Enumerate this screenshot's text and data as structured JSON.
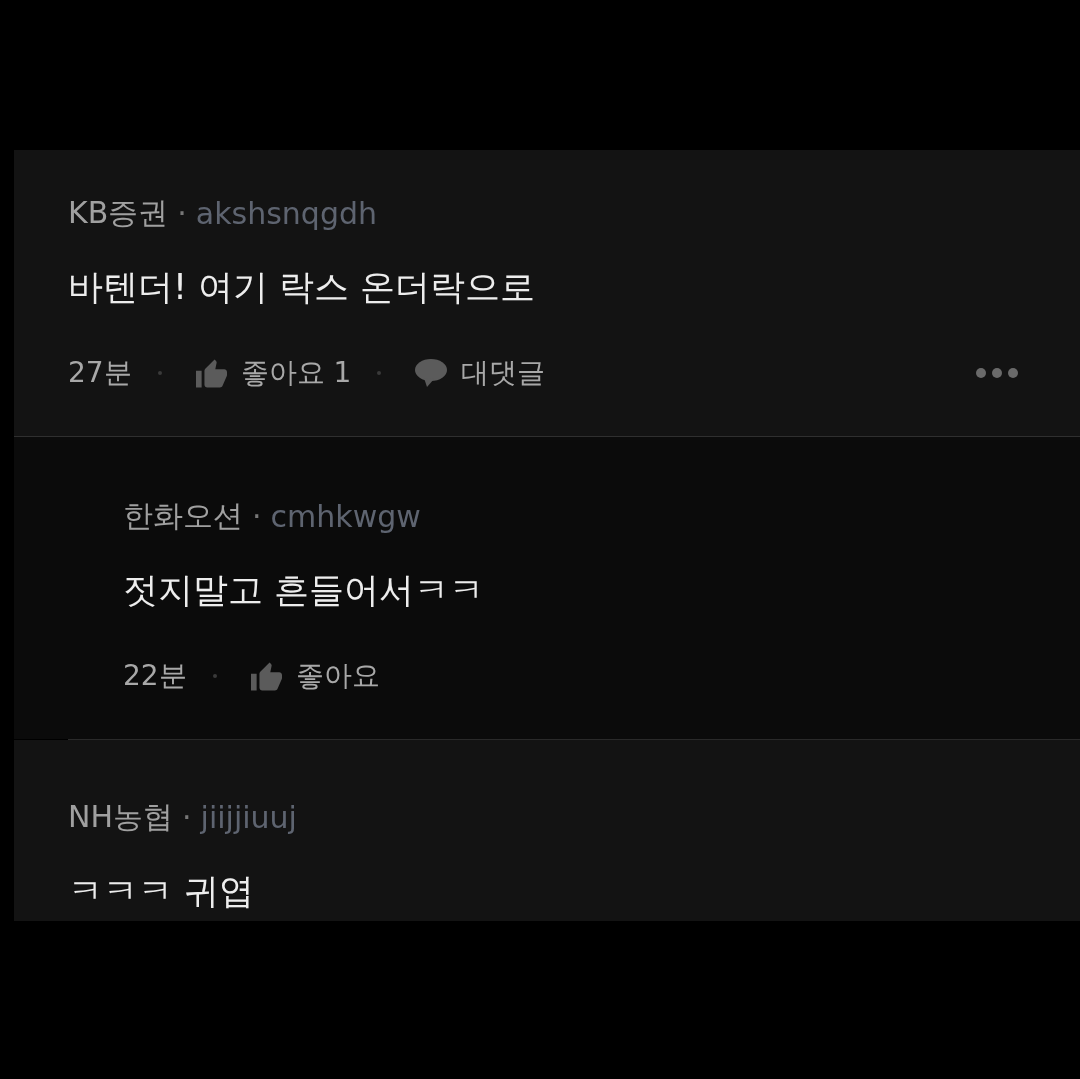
{
  "comments": [
    {
      "author": "KB증권",
      "separator": "·",
      "handle": "akshsnqgdh",
      "text": "바텐더! 여기 락스 온더락으로",
      "time": "27분",
      "actions": [
        {
          "kind": "like",
          "label": "좋아요 1"
        },
        {
          "kind": "reply",
          "label": "대댓글"
        }
      ],
      "more_menu": true,
      "replies": [
        {
          "author": "한화오션",
          "separator": "·",
          "handle": "cmhkwgw",
          "text": "젓지말고 흔들어서ㅋㅋ",
          "time": "22분",
          "actions": [
            {
              "kind": "like",
              "label": "좋아요"
            }
          ]
        }
      ]
    },
    {
      "author": "NH농협",
      "separator": "·",
      "handle": "jiijjiuuj",
      "text": "ㅋㅋㅋ 귀엽"
    }
  ]
}
